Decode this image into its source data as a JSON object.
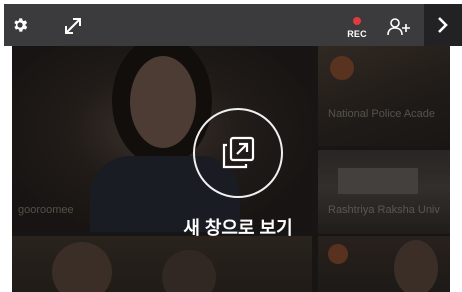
{
  "toolbar": {
    "settings_icon": "gear-icon",
    "expand_icon": "expand-arrows-icon",
    "rec_label": "REC",
    "rec_color": "#e0393e",
    "invite_icon": "add-person-icon",
    "next_icon": "chevron-right-icon"
  },
  "participants": [
    {
      "name": "gooroomee"
    },
    {
      "name": "National Police Acade"
    },
    {
      "name": "Rashtriya Raksha Univ"
    }
  ],
  "overlay": {
    "icon": "open-in-new-window-icon",
    "label": "새 창으로 보기"
  },
  "colors": {
    "toolbar_bg": "#3b3b3e",
    "next_bg": "#222225",
    "accent_rec": "#e0393e"
  }
}
